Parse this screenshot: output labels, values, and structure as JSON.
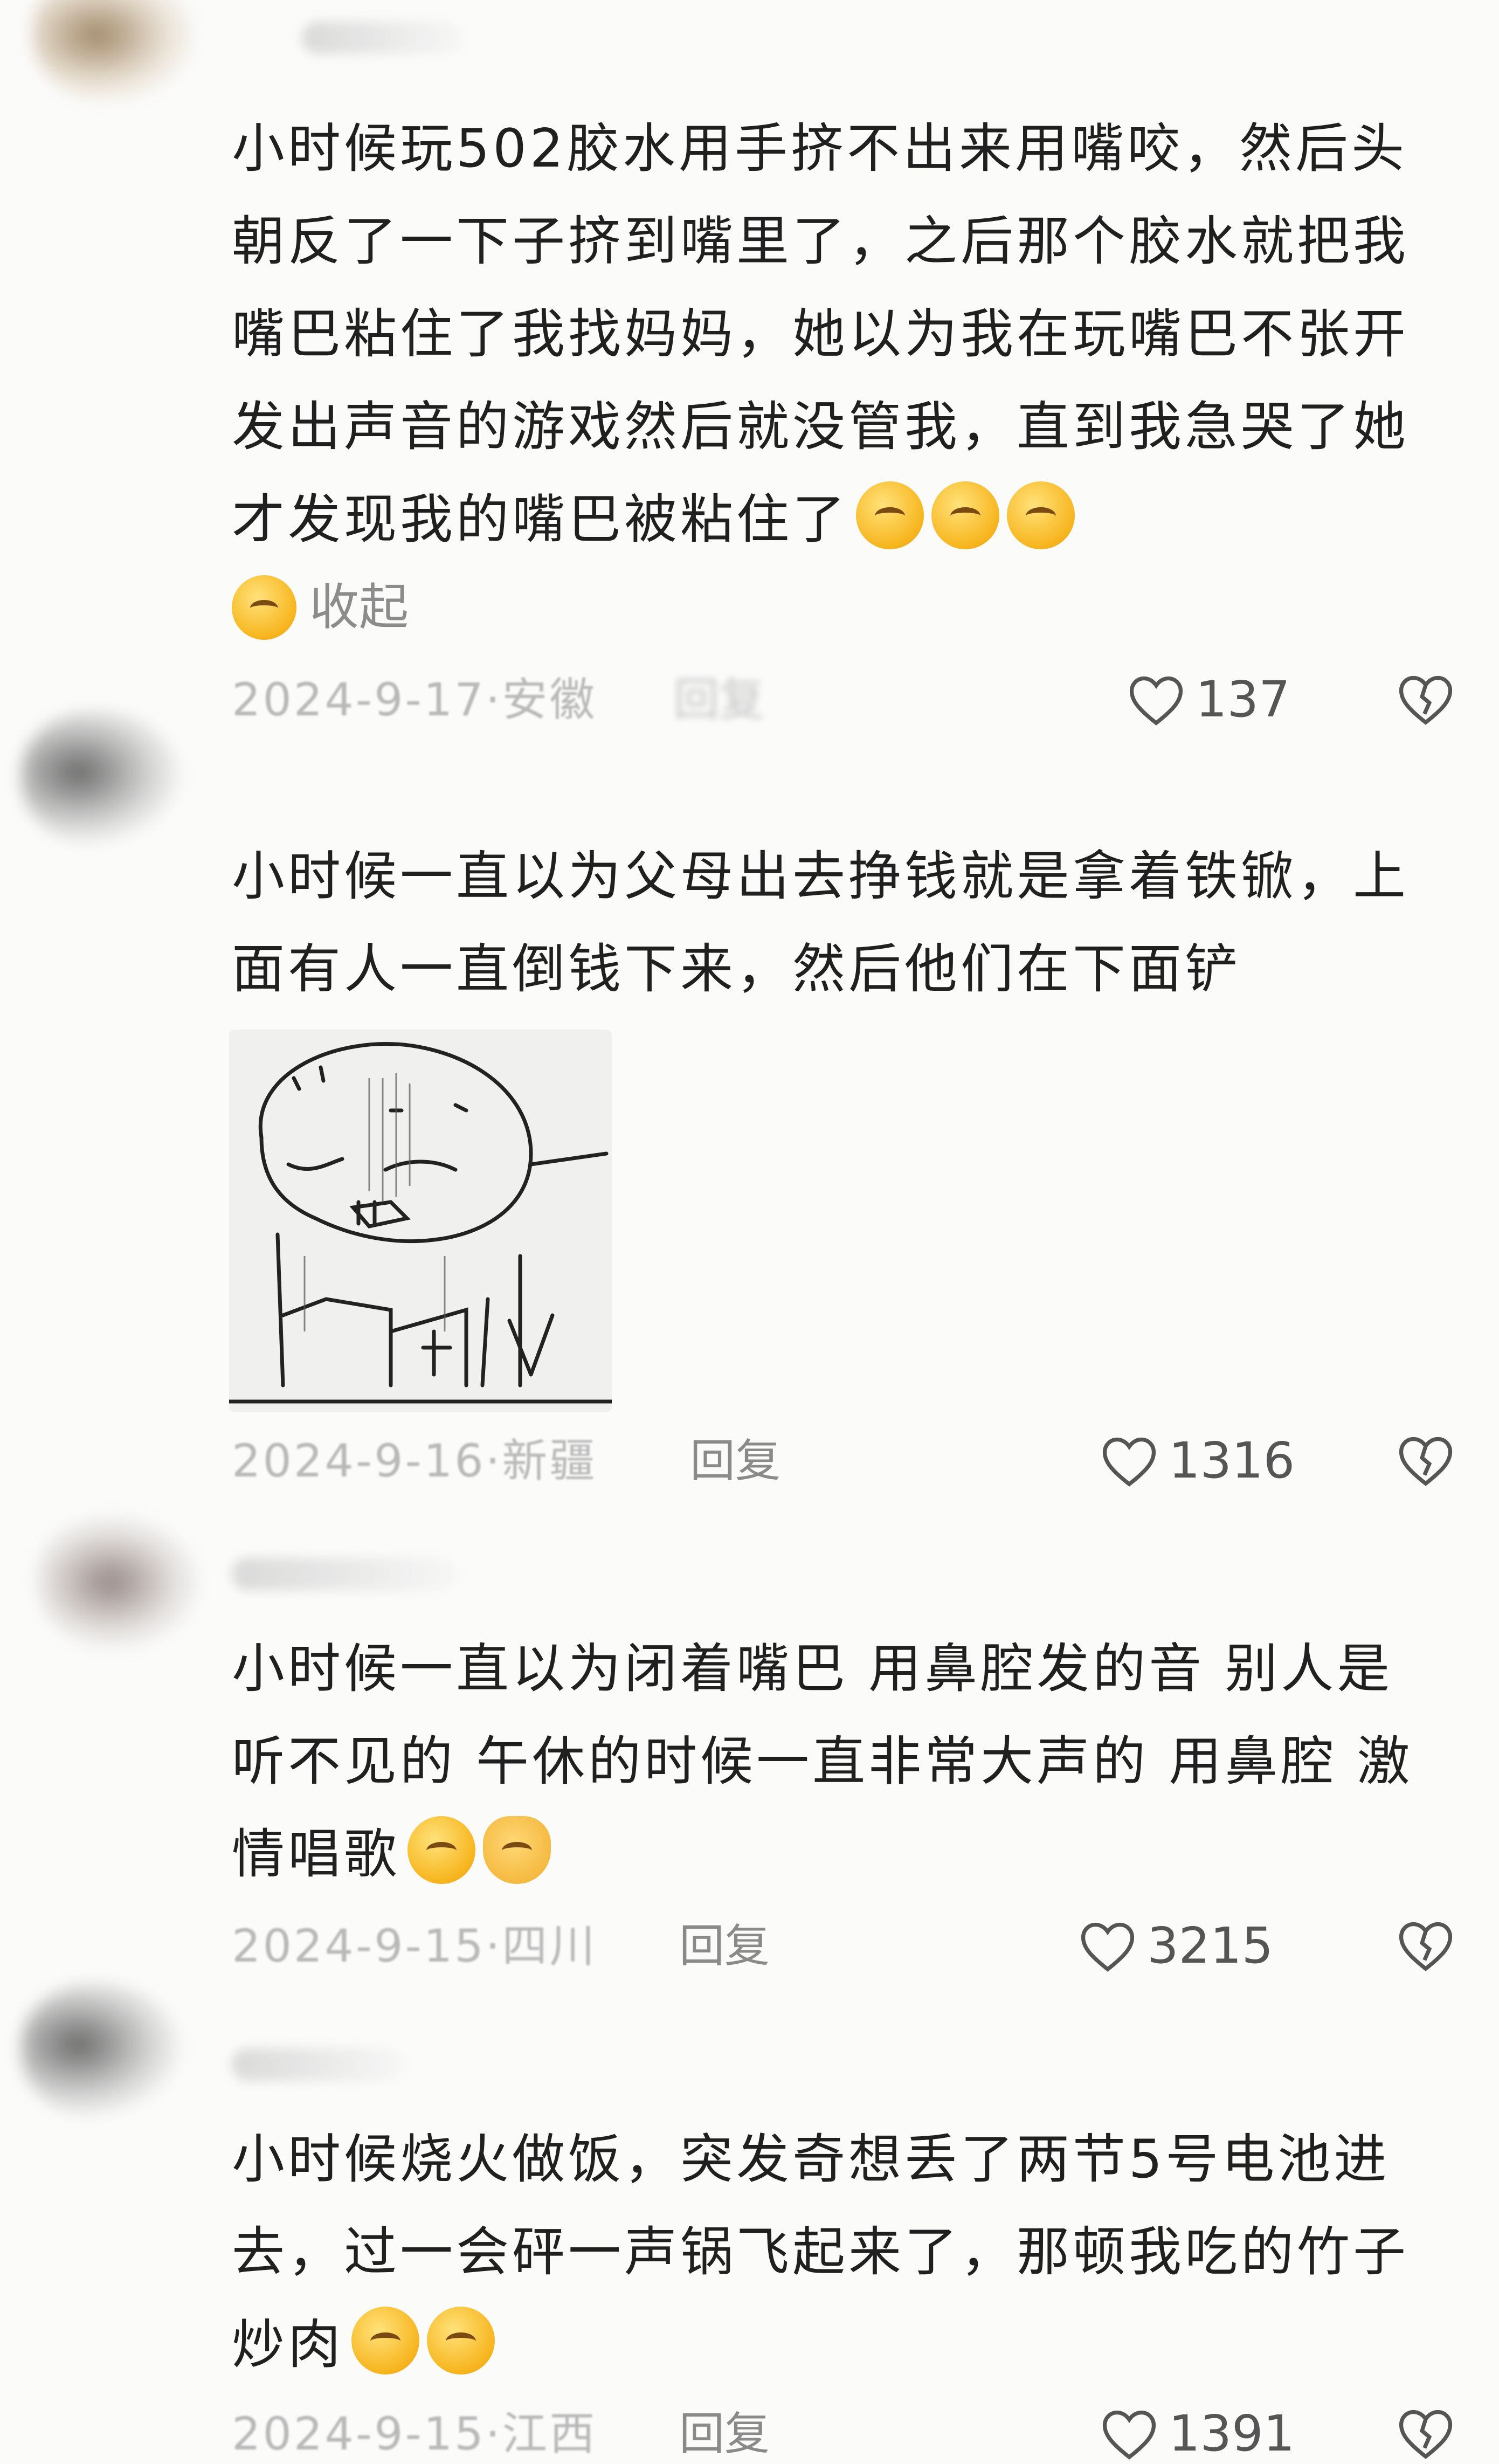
{
  "comments": [
    {
      "text": "小时候玩502胶水用手挤不出来用嘴咬，然后头朝反了一下子挤到嘴里了，之后那个胶水就把我嘴巴粘住了我找妈妈，她以为我在玩嘴巴不张开发出声音的游戏然后就没管我，直到我急哭了她才发现我的嘴巴被粘住了",
      "collapse_label": "收起",
      "date": "2024-9-17·安徽",
      "reply_label": "回复",
      "likes": "137"
    },
    {
      "text": "小时候一直以为父母出去挣钱就是拿着铁锨，上面有人一直倒钱下来，然后他们在下面铲",
      "date": "2024-9-16·新疆",
      "reply_label": "回复",
      "likes": "1316"
    },
    {
      "text": "小时候一直以为闭着嘴巴 用鼻腔发的音 别人是听不见的 午休的时候一直非常大声的 用鼻腔 激情唱歌",
      "date": "2024-9-15·四川",
      "reply_label": "回复",
      "likes": "3215"
    },
    {
      "text": "小时候烧火做饭，突发奇想丢了两节5号电池进去，过一会砰一声锅飞起来了，那顿我吃的竹子炒肉",
      "date": "2024-9-15·江西",
      "reply_label": "回复",
      "likes": "1391"
    }
  ],
  "icons": {
    "like": "heart-outline-icon",
    "dislike": "broken-heart-icon",
    "crying_emoji": "pleading-face-emoji",
    "laughing_emoji": "rolling-laughing-emoji",
    "ok_emoji": "ok-hand-emoji",
    "grin_emoji": "grinning-teeth-emoji"
  }
}
